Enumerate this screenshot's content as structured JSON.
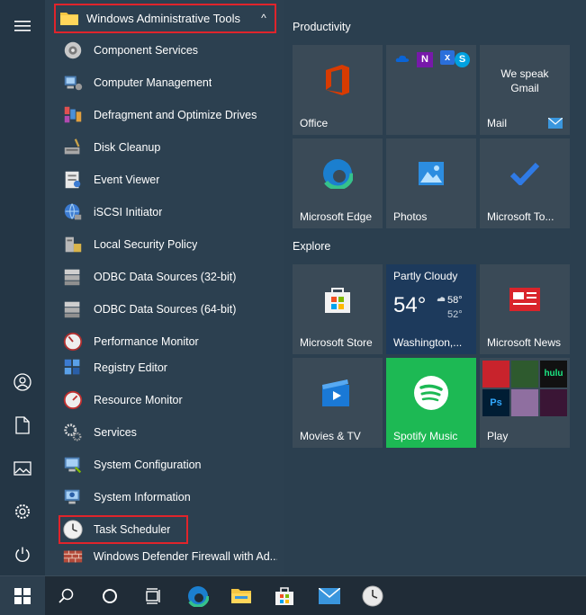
{
  "app_list": {
    "folder_label": "Windows Administrative Tools",
    "folder_chevron": "^",
    "items": [
      {
        "label": "Component Services",
        "icon": "component-services-icon"
      },
      {
        "label": "Computer Management",
        "icon": "computer-management-icon"
      },
      {
        "label": "Defragment and Optimize Drives",
        "icon": "defrag-icon"
      },
      {
        "label": "Disk Cleanup",
        "icon": "disk-cleanup-icon"
      },
      {
        "label": "Event Viewer",
        "icon": "event-viewer-icon"
      },
      {
        "label": "iSCSI Initiator",
        "icon": "iscsi-icon"
      },
      {
        "label": "Local Security Policy",
        "icon": "security-policy-icon"
      },
      {
        "label": "ODBC Data Sources (32-bit)",
        "icon": "odbc-icon"
      },
      {
        "label": "ODBC Data Sources (64-bit)",
        "icon": "odbc-icon"
      },
      {
        "label": "Performance Monitor",
        "icon": "performance-monitor-icon"
      },
      {
        "label": "Registry Editor",
        "icon": "registry-editor-icon"
      },
      {
        "label": "Resource Monitor",
        "icon": "resource-monitor-icon"
      },
      {
        "label": "Services",
        "icon": "services-gear-icon"
      },
      {
        "label": "System Configuration",
        "icon": "system-configuration-icon"
      },
      {
        "label": "System Information",
        "icon": "system-information-icon"
      },
      {
        "label": "Task Scheduler",
        "icon": "clock-icon"
      },
      {
        "label": "Windows Defender Firewall with Ad...",
        "icon": "firewall-icon"
      }
    ]
  },
  "tiles": {
    "productivity_label": "Productivity",
    "explore_label": "Explore",
    "office": "Office",
    "mail": "Mail",
    "mail_promo_line1": "We speak",
    "mail_promo_line2": "Gmail",
    "edge": "Microsoft Edge",
    "photos": "Photos",
    "todo": "Microsoft To...",
    "store": "Microsoft Store",
    "weather_condition": "Partly Cloudy",
    "weather_temp": "54°",
    "weather_high": "58°",
    "weather_low": "52°",
    "weather_location": "Washington,...",
    "news": "Microsoft News",
    "movies": "Movies & TV",
    "spotify": "Spotify Music",
    "play": "Play",
    "hulu": "hulu",
    "ps": "Ps"
  },
  "colors": {
    "highlight_border": "#e0242b",
    "spotify_green": "#1db954",
    "news_red": "#d9242b",
    "office_red": "#d83b01"
  }
}
